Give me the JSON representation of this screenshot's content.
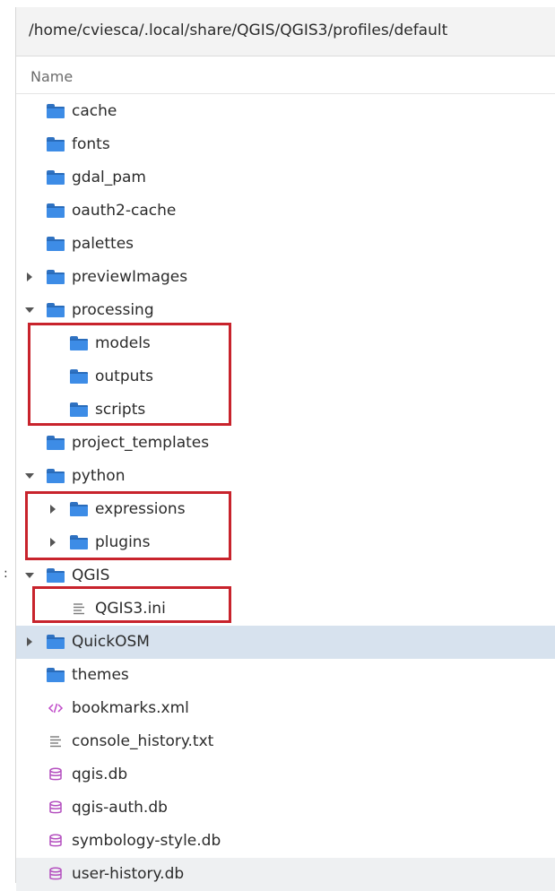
{
  "path": "/home/cviesca/.local/share/QGIS/QGIS3/profiles/default",
  "column_header": "Name",
  "stray_glyph": ":",
  "rows": [
    {
      "label": "cache",
      "icon": "folder-icon",
      "arrow": "none",
      "depth": 0
    },
    {
      "label": "fonts",
      "icon": "folder-icon",
      "arrow": "none",
      "depth": 0
    },
    {
      "label": "gdal_pam",
      "icon": "folder-icon",
      "arrow": "none",
      "depth": 0
    },
    {
      "label": "oauth2-cache",
      "icon": "folder-icon",
      "arrow": "none",
      "depth": 0
    },
    {
      "label": "palettes",
      "icon": "folder-icon",
      "arrow": "none",
      "depth": 0
    },
    {
      "label": "previewImages",
      "icon": "folder-icon",
      "arrow": "collapsed",
      "depth": 0
    },
    {
      "label": "processing",
      "icon": "folder-icon",
      "arrow": "expanded",
      "depth": 0
    },
    {
      "label": "models",
      "icon": "folder-icon",
      "arrow": "none",
      "depth": 1
    },
    {
      "label": "outputs",
      "icon": "folder-icon",
      "arrow": "none",
      "depth": 1
    },
    {
      "label": "scripts",
      "icon": "folder-icon",
      "arrow": "none",
      "depth": 1
    },
    {
      "label": "project_templates",
      "icon": "folder-icon",
      "arrow": "none",
      "depth": 0
    },
    {
      "label": "python",
      "icon": "folder-icon",
      "arrow": "expanded",
      "depth": 0
    },
    {
      "label": "expressions",
      "icon": "folder-icon",
      "arrow": "collapsed",
      "depth": 1
    },
    {
      "label": "plugins",
      "icon": "folder-icon",
      "arrow": "collapsed",
      "depth": 1
    },
    {
      "label": "QGIS",
      "icon": "folder-icon",
      "arrow": "expanded",
      "depth": 0
    },
    {
      "label": "QGIS3.ini",
      "icon": "text-file-icon",
      "arrow": "none",
      "depth": 1
    },
    {
      "label": "QuickOSM",
      "icon": "folder-icon",
      "arrow": "collapsed",
      "depth": 0,
      "state": "selected"
    },
    {
      "label": "themes",
      "icon": "folder-icon",
      "arrow": "none",
      "depth": 0
    },
    {
      "label": "bookmarks.xml",
      "icon": "xml-file-icon",
      "arrow": "none",
      "depth": 0
    },
    {
      "label": "console_history.txt",
      "icon": "text-file-icon",
      "arrow": "none",
      "depth": 0
    },
    {
      "label": "qgis.db",
      "icon": "database-icon",
      "arrow": "none",
      "depth": 0
    },
    {
      "label": "qgis-auth.db",
      "icon": "database-icon",
      "arrow": "none",
      "depth": 0
    },
    {
      "label": "symbology-style.db",
      "icon": "database-icon",
      "arrow": "none",
      "depth": 0
    },
    {
      "label": "user-history.db",
      "icon": "database-icon",
      "arrow": "none",
      "depth": 0,
      "state": "hover"
    }
  ],
  "highlight_color": "#c8232c",
  "selection_color": "#d7e2ee",
  "folder_color": "#3d8ce6"
}
